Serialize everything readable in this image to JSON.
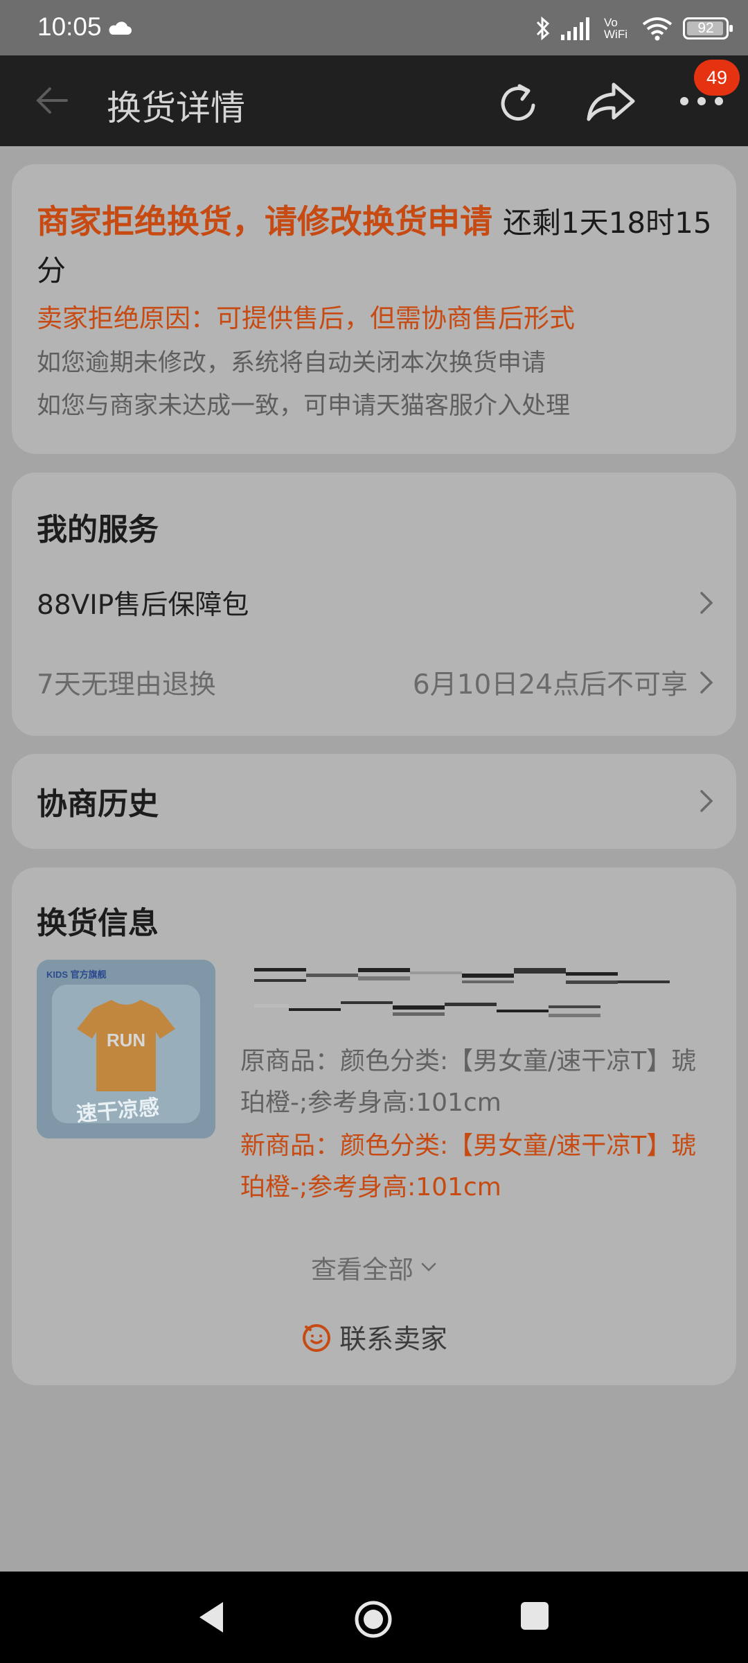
{
  "status_bar": {
    "time": "10:05",
    "vowifi_top": "Vo",
    "vowifi_bottom": "WiFi",
    "battery": "92"
  },
  "app_bar": {
    "title": "换货详情",
    "badge_count": "49"
  },
  "status_card": {
    "headline": "商家拒绝换货，请修改换货申请",
    "countdown": "还剩1天18时15分",
    "reason": "卖家拒绝原因：可提供售后，但需协商售后形式",
    "note_1": "如您逾期未修改，系统将自动关闭本次换货申请",
    "note_2": "如您与商家未达成一致，可申请天猫客服介入处理"
  },
  "my_service": {
    "title": "我的服务",
    "item_1": "88VIP售后保障包",
    "item_2": "7天无理由退换",
    "item_2_value": "6月10日24点后不可享"
  },
  "negotiation": {
    "title": "协商历史"
  },
  "exchange_info": {
    "title": "换货信息",
    "thumbnail_brand": "KIDS 官方旗舰",
    "thumbnail_shirt_text": "RUN",
    "thumbnail_caption": "速干凉感",
    "original_item": "原商品：颜色分类:【男女童/速干凉T】琥珀橙-;参考身高:101cm",
    "new_item": "新商品：颜色分类:【男女童/速干凉T】琥珀橙-;参考身高:101cm",
    "view_all": "查看全部",
    "contact_seller": "联系卖家"
  },
  "colors": {
    "accent": "#c64a12",
    "badge": "#e53312",
    "card": "#b4b4b4",
    "background": "#a5a5a5"
  },
  "icons": [
    "back-arrow-icon",
    "refresh-icon",
    "share-icon",
    "more-icon",
    "chevron-right-icon",
    "chevron-down-icon",
    "smile-icon",
    "nav-back-icon",
    "nav-home-icon",
    "nav-recent-icon"
  ]
}
